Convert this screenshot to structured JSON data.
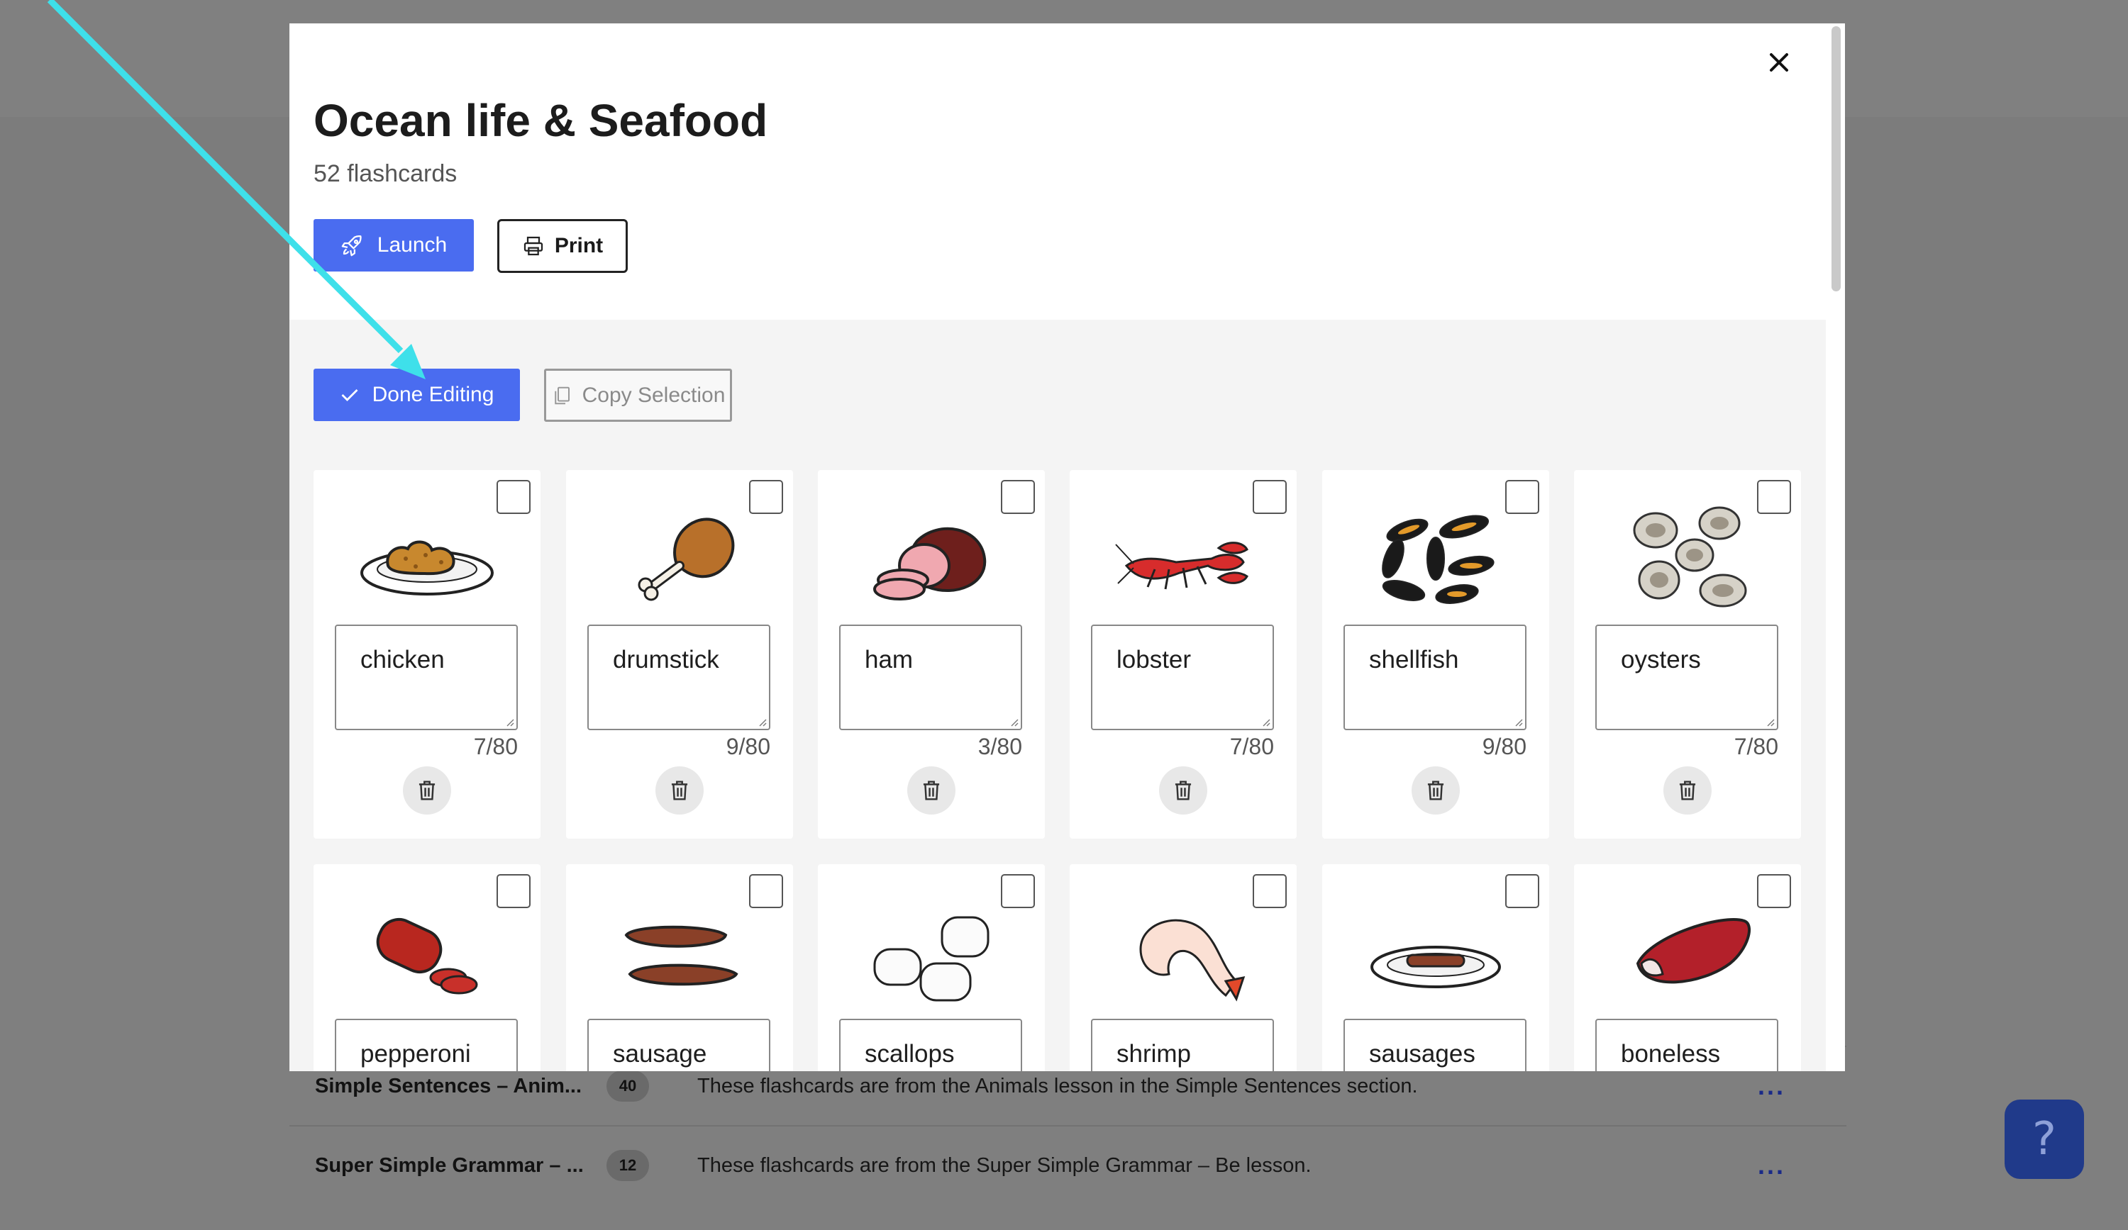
{
  "background": {
    "rows": [
      {
        "title": "Simple Sentences – Anim...",
        "count": "40",
        "description": "These flashcards are from the Animals lesson in the Simple Sentences section.",
        "menu": "..."
      },
      {
        "title": "Super Simple Grammar – ...",
        "count": "12",
        "description": "These flashcards are from the Super Simple Grammar – Be lesson.",
        "menu": "..."
      }
    ],
    "help_label": "?"
  },
  "modal": {
    "title": "Ocean life & Seafood",
    "subtitle": "52 flashcards",
    "launch_label": "Launch",
    "print_label": "Print",
    "done_label": "Done Editing",
    "copy_label": "Copy Selection",
    "cards_row1": [
      {
        "word": "chicken",
        "count": "7/80",
        "icon": "fried-chicken-plate"
      },
      {
        "word": "drumstick",
        "count": "9/80",
        "icon": "drumstick"
      },
      {
        "word": "ham",
        "count": "3/80",
        "icon": "ham"
      },
      {
        "word": "lobster",
        "count": "7/80",
        "icon": "lobster"
      },
      {
        "word": "shellfish",
        "count": "9/80",
        "icon": "mussels"
      },
      {
        "word": "oysters",
        "count": "7/80",
        "icon": "oysters"
      }
    ],
    "cards_row2": [
      {
        "word": "pepperoni",
        "icon": "pepperoni"
      },
      {
        "word": "sausage",
        "icon": "sausage"
      },
      {
        "word": "scallops",
        "icon": "scallops"
      },
      {
        "word": "shrimp",
        "icon": "shrimp"
      },
      {
        "word": "sausages",
        "icon": "sausages-plate"
      },
      {
        "word": "boneless",
        "icon": "boneless-meat"
      }
    ]
  },
  "colors": {
    "primary": "#4a6cf0",
    "annotation_arrow": "#3ee0ea"
  }
}
